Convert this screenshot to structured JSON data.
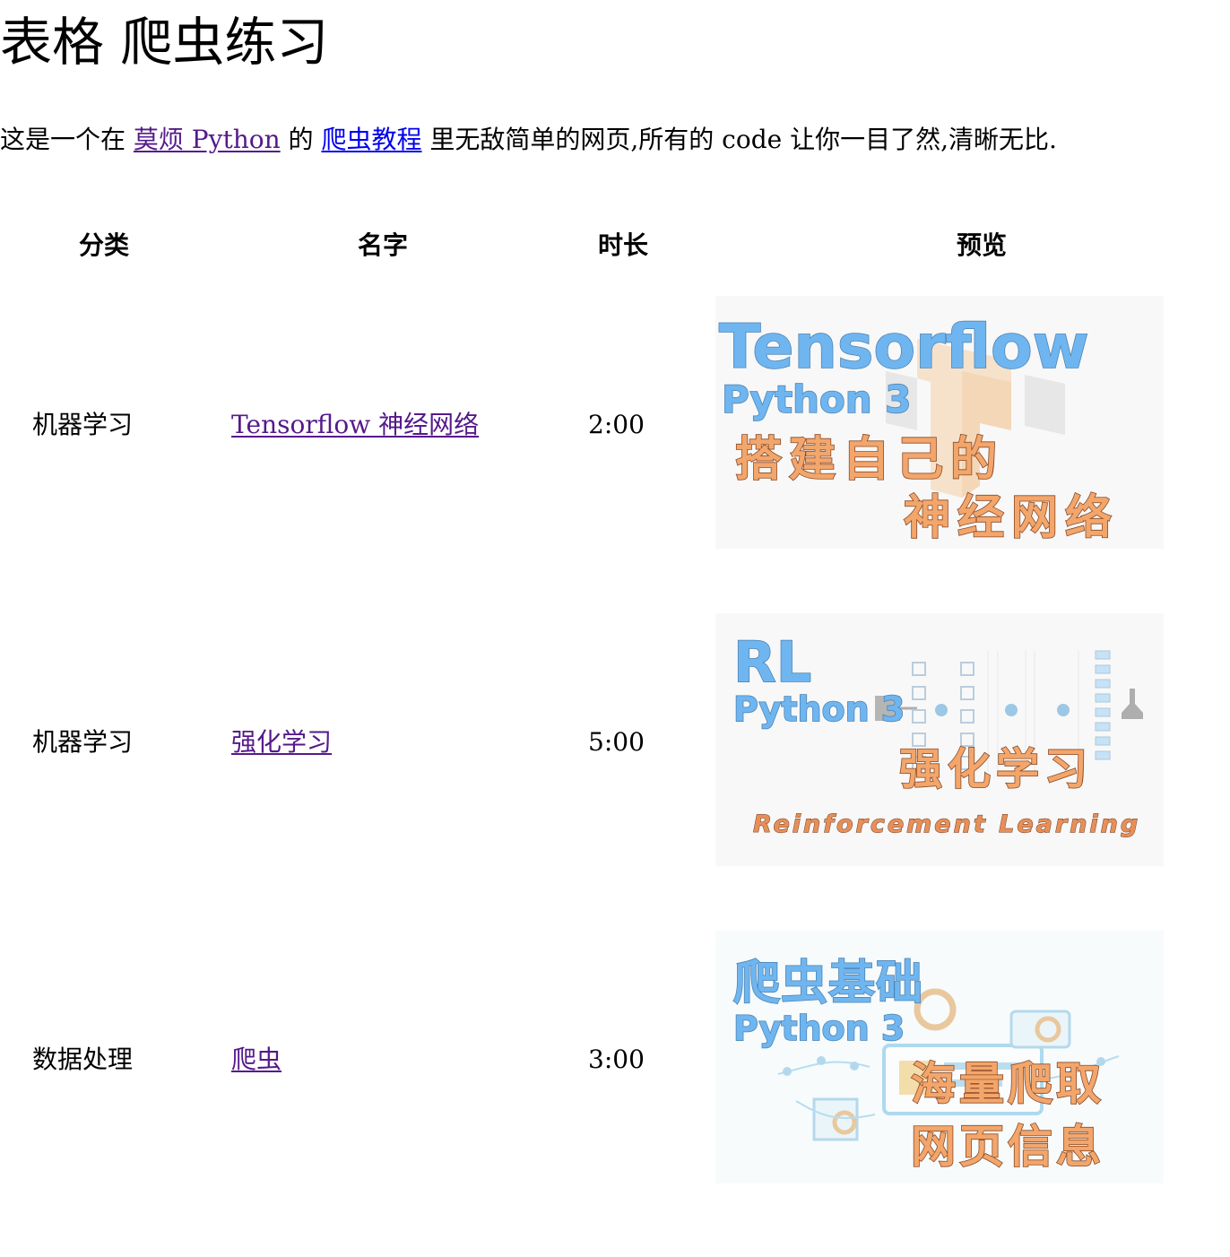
{
  "page": {
    "title": "表格 爬虫练习"
  },
  "intro": {
    "prefix": "这是一个在 ",
    "site_link": "莫烦 Python",
    "middle": " 的 ",
    "tutorial_link": "爬虫教程",
    "suffix": " 里无敌简单的网页,所有的 code 让你一目了然,清晰无比."
  },
  "table": {
    "headers": {
      "category": "分类",
      "name": "名字",
      "duration": "时长",
      "preview": "预览"
    },
    "rows": [
      {
        "category": "机器学习",
        "name": "Tensorflow 神经网络",
        "duration": "2:00",
        "preview": {
          "title": "Tensorflow",
          "subtitle": "Python 3",
          "line1": "搭建自己的",
          "line2": "神经网络"
        }
      },
      {
        "category": "机器学习",
        "name": "强化学习",
        "duration": "5:00",
        "preview": {
          "title": "RL",
          "subtitle": "Python 3",
          "line1": "强化学习",
          "caption": "Reinforcement Learning"
        }
      },
      {
        "category": "数据处理",
        "name": "爬虫",
        "duration": "3:00",
        "preview": {
          "title": "爬虫基础",
          "subtitle": "Python 3",
          "line1": "海量爬取",
          "line2": "网页信息"
        }
      }
    ]
  },
  "colors": {
    "link_visited": "#551a8b",
    "link_unvisited": "#0000ee",
    "preview_blue": "#6fb6f1",
    "preview_orange": "#f3a66b"
  },
  "icons": {
    "tensorflow_preview": "tensorflow-logo-icon",
    "rl_preview": "neural-network-diagram-icon",
    "crawler_preview": "web-crawler-dashboard-icon"
  }
}
